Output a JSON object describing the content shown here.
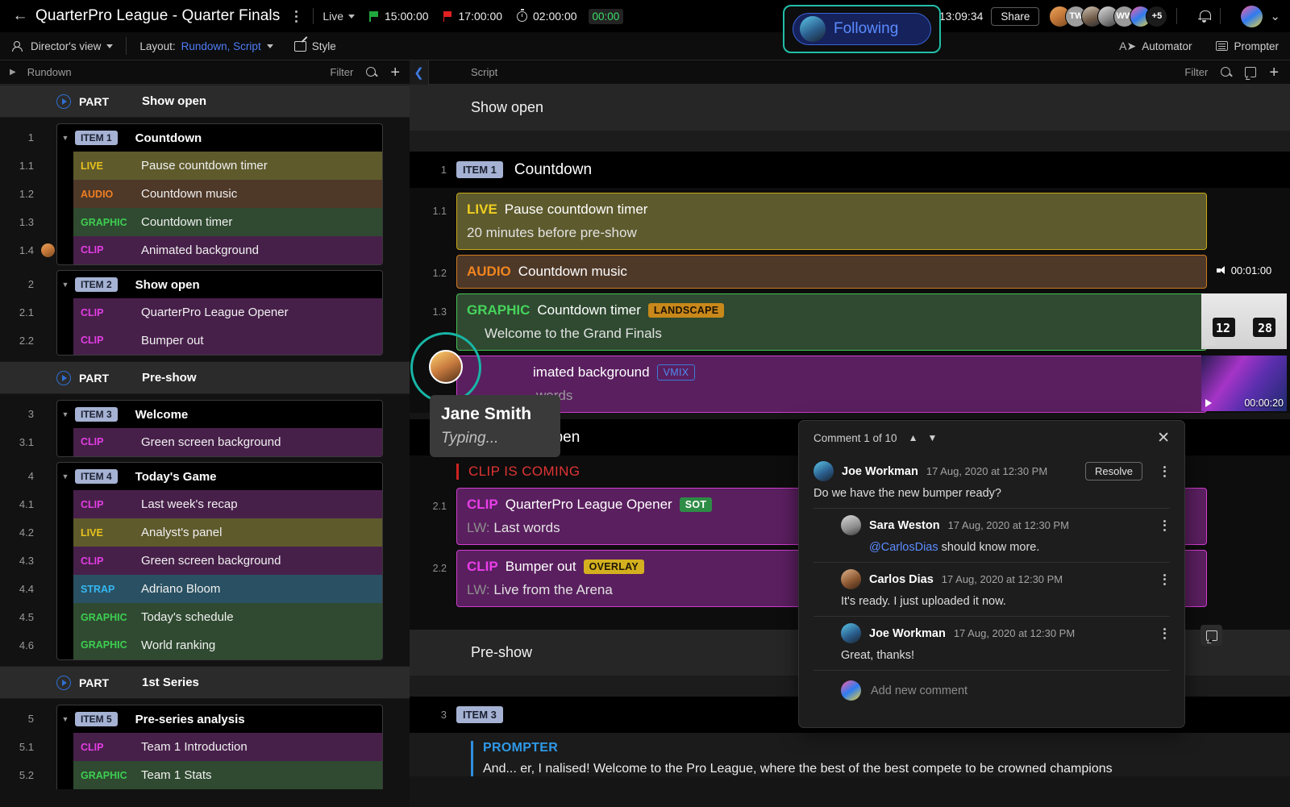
{
  "topbar": {
    "back_icon": "back-arrow-icon",
    "title": "QuarterPro League - Quarter Finals",
    "mode": "Live",
    "start_time": "15:00:00",
    "end_time": "17:00:00",
    "duration": "02:00:00",
    "elapsed": "00:00",
    "clock": "13:09:34",
    "share_label": "Share",
    "avatar_overflow": "+5",
    "avatar_initials": [
      "",
      "TW",
      "",
      "",
      "WW",
      ""
    ],
    "following_label": "Following",
    "accent_following_border": "#21bfa8",
    "accent_following_text": "#5b8cff"
  },
  "subbar": {
    "view_label": "Director's view",
    "layout_prefix": "Layout:",
    "layout_value": "Rundown, Script",
    "style_label": "Style",
    "automator_label": "Automator",
    "prompter_label": "Prompter"
  },
  "rundown": {
    "header_title": "Rundown",
    "filter_label": "Filter",
    "rows": [
      {
        "type": "part",
        "label": "PART",
        "name": "Show open"
      },
      {
        "type": "item",
        "num": "1",
        "badge": "ITEM 1",
        "title": "Countdown",
        "subs": [
          {
            "num": "1.1",
            "kind": "LIVE",
            "kindclass": "k-live",
            "text": "Pause countdown timer"
          },
          {
            "num": "1.2",
            "kind": "AUDIO",
            "kindclass": "k-audio",
            "text": "Countdown music"
          },
          {
            "num": "1.3",
            "kind": "GRAPHIC",
            "kindclass": "k-graphic",
            "text": "Countdown timer"
          },
          {
            "num": "1.4",
            "kind": "CLIP",
            "kindclass": "k-clip",
            "text": "Animated background",
            "avatar": true
          }
        ]
      },
      {
        "type": "item",
        "num": "2",
        "badge": "ITEM 2",
        "title": "Show open",
        "subs": [
          {
            "num": "2.1",
            "kind": "CLIP",
            "kindclass": "k-clip",
            "text": "QuarterPro League Opener"
          },
          {
            "num": "2.2",
            "kind": "CLIP",
            "kindclass": "k-clip",
            "text": "Bumper out"
          }
        ]
      },
      {
        "type": "part",
        "label": "PART",
        "name": "Pre-show"
      },
      {
        "type": "item",
        "num": "3",
        "badge": "ITEM 3",
        "title": "Welcome",
        "subs": [
          {
            "num": "3.1",
            "kind": "CLIP",
            "kindclass": "k-clip",
            "text": "Green screen background"
          }
        ]
      },
      {
        "type": "item",
        "num": "4",
        "badge": "ITEM 4",
        "title": "Today's Game",
        "subs": [
          {
            "num": "4.1",
            "kind": "CLIP",
            "kindclass": "k-clip",
            "text": "Last week's recap"
          },
          {
            "num": "4.2",
            "kind": "LIVE",
            "kindclass": "k-live",
            "text": "Analyst's panel"
          },
          {
            "num": "4.3",
            "kind": "CLIP",
            "kindclass": "k-clip",
            "text": "Green screen background"
          },
          {
            "num": "4.4",
            "kind": "STRAP",
            "kindclass": "k-strap",
            "text": "Adriano Bloom"
          },
          {
            "num": "4.5",
            "kind": "GRAPHIC",
            "kindclass": "k-graphic",
            "text": "Today's schedule"
          },
          {
            "num": "4.6",
            "kind": "GRAPHIC",
            "kindclass": "k-graphic",
            "text": "World ranking"
          }
        ]
      },
      {
        "type": "part",
        "label": "PART",
        "name": "1st Series"
      },
      {
        "type": "item",
        "num": "5",
        "badge": "ITEM 5",
        "title": "Pre-series analysis",
        "subs": [
          {
            "num": "5.1",
            "kind": "CLIP",
            "kindclass": "k-clip",
            "text": "Team 1 Introduction"
          },
          {
            "num": "5.2",
            "kind": "GRAPHIC",
            "kindclass": "k-graphic",
            "text": "Team 1 Stats"
          }
        ]
      }
    ]
  },
  "script": {
    "header_title": "Script",
    "filter_label": "Filter",
    "section1": "Show open",
    "item1": {
      "num": "1",
      "badge": "ITEM 1",
      "name": "Countdown"
    },
    "b11": {
      "num": "1.1",
      "kind": "LIVE",
      "title": "Pause countdown timer",
      "line2": "20 minutes before pre-show"
    },
    "b12": {
      "num": "1.2",
      "kind": "AUDIO",
      "title": "Countdown music",
      "duration": "00:01:00"
    },
    "b13": {
      "num": "1.3",
      "kind": "GRAPHIC",
      "title": "Countdown timer",
      "tag": "LANDSCAPE",
      "line2": "Welcome to the Grand Finals",
      "thumb_left": "12",
      "thumb_right": "28"
    },
    "b14": {
      "num": "1.4",
      "kind": "CLIP",
      "title": "imated background",
      "tag": "VMIX",
      "line2": "words",
      "duration": "00:00:20"
    },
    "item2": {
      "num": "2",
      "badge": "ITEM 2",
      "name": "w open"
    },
    "warning": "CLIP IS COMING",
    "b21": {
      "num": "2.1",
      "kind": "CLIP",
      "title": "QuarterPro League Opener",
      "tag": "SOT",
      "lw": "LW:",
      "line2": "Last words"
    },
    "b22": {
      "num": "2.2",
      "kind": "CLIP",
      "title": "Bumper out",
      "tag": "OVERLAY",
      "lw": "LW:",
      "line2": "Live from the Arena"
    },
    "section2": "Pre-show",
    "item3": {
      "num": "3",
      "badge": "ITEM 3",
      "name": ""
    },
    "prompter": {
      "label": "PROMPTER",
      "text": "And... er, I nalised! Welcome to the Pro League, where the best of the best compete to be crowned champions"
    }
  },
  "cursor": {
    "name": "Jane Smith",
    "status": "Typing...",
    "ring_color": "#17b5a5"
  },
  "comments": {
    "counter": "Comment 1 of 10",
    "resolve_label": "Resolve",
    "new_placeholder": "Add new comment",
    "threads": [
      {
        "name": "Joe Workman",
        "time": "17 Aug, 2020 at 12:30 PM",
        "body": "Do we have the new bumper ready?",
        "reply": false,
        "resolve": true,
        "face": "f8"
      },
      {
        "name": "Sara Weston",
        "time": "17 Aug, 2020 at 12:30 PM",
        "mention": "@CarlosDias",
        "body": " should know more.",
        "reply": true,
        "resolve": false,
        "face": "f9"
      },
      {
        "name": "Carlos Dias",
        "time": "17 Aug, 2020 at 12:30 PM",
        "body": "It's ready. I just uploaded it now.",
        "reply": true,
        "resolve": false,
        "face": "f10"
      },
      {
        "name": "Joe Workman",
        "time": "17 Aug, 2020 at 12:30 PM",
        "body": "Great, thanks!",
        "reply": true,
        "resolve": false,
        "face": "f8"
      }
    ]
  }
}
